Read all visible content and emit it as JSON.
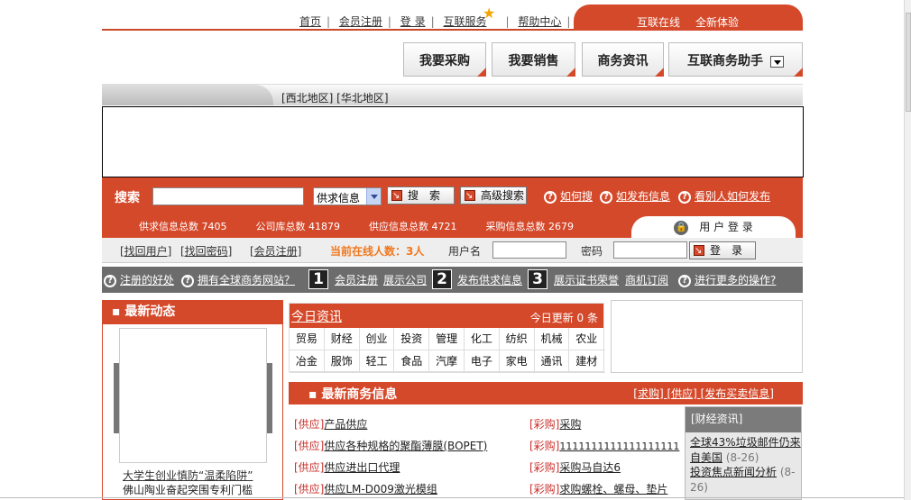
{
  "top_nav": {
    "items": [
      "首页",
      "会员注册",
      "登 录",
      "互联服务",
      "帮助中心"
    ],
    "banner_1": "互联在线",
    "banner_2": "全新体验"
  },
  "tabs": [
    "我要采购",
    "我要销售",
    "商务资讯",
    "互联商务助手"
  ],
  "regions": "[西北地区] [华北地区]",
  "search": {
    "label": "搜索",
    "select_value": "供求信息",
    "search_button": "搜　索",
    "advanced_button": "高级搜索",
    "help_how": "如何搜",
    "help_publish": "如发布信息",
    "help_see": "看别人如何发布"
  },
  "stats": {
    "supply_demand": "供求信息总数 7405",
    "company": "公司库总数 41879",
    "supply": "供应信息总数 4721",
    "purchase": "采购信息总数 2679"
  },
  "login_tab": "用 户 登 录",
  "login": {
    "find_user": "[找回用户]",
    "find_pwd": "[找回密码]",
    "register": "[会员注册]",
    "online": "当前在线人数：3人",
    "username_label": "用户名",
    "password_label": "密码",
    "login_button": "登　录"
  },
  "help_bar": {
    "benefit": "注册的好处",
    "global": "拥有全球商务网站？",
    "step1": "会员注册",
    "step1b": "展示公司",
    "step2": "发布供求信息",
    "step3": "展示证书荣誉",
    "step3b": "商机订阅",
    "more": "进行更多的操作?"
  },
  "news": {
    "title": "最新动态",
    "line1": "大学生创业慎防“温柔陷阱”",
    "line2": "佛山陶业奋起突围专利门槛"
  },
  "today": {
    "title": "今日资讯",
    "update": "今日更新 0 条",
    "row1": [
      "贸易",
      "财经",
      "创业",
      "投资",
      "管理",
      "化工",
      "纺织",
      "机械",
      "农业"
    ],
    "row2": [
      "冶金",
      "服饰",
      "轻工",
      "食品",
      "汽摩",
      "电子",
      "家电",
      "通讯",
      "建材"
    ]
  },
  "biz": {
    "title": "最新商务信息",
    "links": "[求购] [供应] [发布买卖信息]",
    "left": [
      {
        "tag": "[供应]",
        "text": "产品供应"
      },
      {
        "tag": "[供应]",
        "text": "供应各种规格的聚酯薄膜(BOPET)"
      },
      {
        "tag": "[供应]",
        "text": "供应进出口代理"
      },
      {
        "tag": "[供应]",
        "text": "供应LM-D009激光模组"
      }
    ],
    "right": [
      {
        "tag": "[彩购]",
        "text": "采购"
      },
      {
        "tag": "[彩购]",
        "text": "1111111111111111111"
      },
      {
        "tag": "[彩购]",
        "text": "采购马自达6"
      },
      {
        "tag": "[彩购]",
        "text": "求购螺栓、螺母、垫片"
      }
    ]
  },
  "finance": {
    "title": "[财经资讯]",
    "item1": "全球43%垃圾邮件仍来自美国",
    "item1_date": "(8-26)",
    "item2": "投资焦点新闻分析",
    "item2_date": "(8-26)"
  },
  "colors": {
    "accent": "#d5492b",
    "grey_bar": "#6c6c6c",
    "online": "#f0781e"
  }
}
